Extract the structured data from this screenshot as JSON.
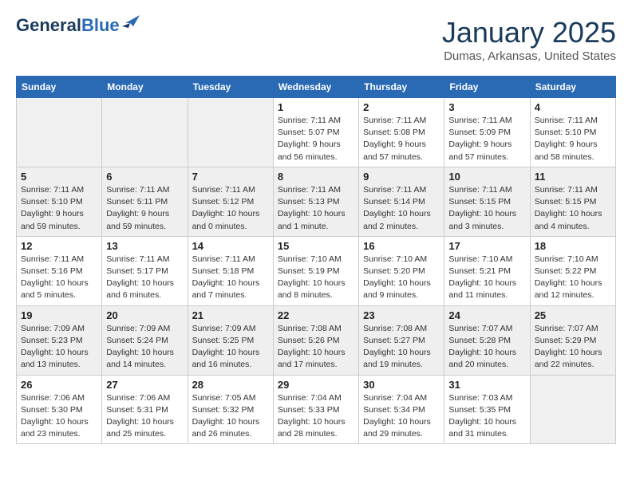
{
  "header": {
    "logo_line1": "General",
    "logo_line2": "Blue",
    "month": "January 2025",
    "location": "Dumas, Arkansas, United States"
  },
  "weekdays": [
    "Sunday",
    "Monday",
    "Tuesday",
    "Wednesday",
    "Thursday",
    "Friday",
    "Saturday"
  ],
  "weeks": [
    [
      {
        "day": "",
        "sunrise": "",
        "sunset": "",
        "daylight": ""
      },
      {
        "day": "",
        "sunrise": "",
        "sunset": "",
        "daylight": ""
      },
      {
        "day": "",
        "sunrise": "",
        "sunset": "",
        "daylight": ""
      },
      {
        "day": "1",
        "sunrise": "Sunrise: 7:11 AM",
        "sunset": "Sunset: 5:07 PM",
        "daylight": "Daylight: 9 hours and 56 minutes."
      },
      {
        "day": "2",
        "sunrise": "Sunrise: 7:11 AM",
        "sunset": "Sunset: 5:08 PM",
        "daylight": "Daylight: 9 hours and 57 minutes."
      },
      {
        "day": "3",
        "sunrise": "Sunrise: 7:11 AM",
        "sunset": "Sunset: 5:09 PM",
        "daylight": "Daylight: 9 hours and 57 minutes."
      },
      {
        "day": "4",
        "sunrise": "Sunrise: 7:11 AM",
        "sunset": "Sunset: 5:10 PM",
        "daylight": "Daylight: 9 hours and 58 minutes."
      }
    ],
    [
      {
        "day": "5",
        "sunrise": "Sunrise: 7:11 AM",
        "sunset": "Sunset: 5:10 PM",
        "daylight": "Daylight: 9 hours and 59 minutes."
      },
      {
        "day": "6",
        "sunrise": "Sunrise: 7:11 AM",
        "sunset": "Sunset: 5:11 PM",
        "daylight": "Daylight: 9 hours and 59 minutes."
      },
      {
        "day": "7",
        "sunrise": "Sunrise: 7:11 AM",
        "sunset": "Sunset: 5:12 PM",
        "daylight": "Daylight: 10 hours and 0 minutes."
      },
      {
        "day": "8",
        "sunrise": "Sunrise: 7:11 AM",
        "sunset": "Sunset: 5:13 PM",
        "daylight": "Daylight: 10 hours and 1 minute."
      },
      {
        "day": "9",
        "sunrise": "Sunrise: 7:11 AM",
        "sunset": "Sunset: 5:14 PM",
        "daylight": "Daylight: 10 hours and 2 minutes."
      },
      {
        "day": "10",
        "sunrise": "Sunrise: 7:11 AM",
        "sunset": "Sunset: 5:15 PM",
        "daylight": "Daylight: 10 hours and 3 minutes."
      },
      {
        "day": "11",
        "sunrise": "Sunrise: 7:11 AM",
        "sunset": "Sunset: 5:15 PM",
        "daylight": "Daylight: 10 hours and 4 minutes."
      }
    ],
    [
      {
        "day": "12",
        "sunrise": "Sunrise: 7:11 AM",
        "sunset": "Sunset: 5:16 PM",
        "daylight": "Daylight: 10 hours and 5 minutes."
      },
      {
        "day": "13",
        "sunrise": "Sunrise: 7:11 AM",
        "sunset": "Sunset: 5:17 PM",
        "daylight": "Daylight: 10 hours and 6 minutes."
      },
      {
        "day": "14",
        "sunrise": "Sunrise: 7:11 AM",
        "sunset": "Sunset: 5:18 PM",
        "daylight": "Daylight: 10 hours and 7 minutes."
      },
      {
        "day": "15",
        "sunrise": "Sunrise: 7:10 AM",
        "sunset": "Sunset: 5:19 PM",
        "daylight": "Daylight: 10 hours and 8 minutes."
      },
      {
        "day": "16",
        "sunrise": "Sunrise: 7:10 AM",
        "sunset": "Sunset: 5:20 PM",
        "daylight": "Daylight: 10 hours and 9 minutes."
      },
      {
        "day": "17",
        "sunrise": "Sunrise: 7:10 AM",
        "sunset": "Sunset: 5:21 PM",
        "daylight": "Daylight: 10 hours and 11 minutes."
      },
      {
        "day": "18",
        "sunrise": "Sunrise: 7:10 AM",
        "sunset": "Sunset: 5:22 PM",
        "daylight": "Daylight: 10 hours and 12 minutes."
      }
    ],
    [
      {
        "day": "19",
        "sunrise": "Sunrise: 7:09 AM",
        "sunset": "Sunset: 5:23 PM",
        "daylight": "Daylight: 10 hours and 13 minutes."
      },
      {
        "day": "20",
        "sunrise": "Sunrise: 7:09 AM",
        "sunset": "Sunset: 5:24 PM",
        "daylight": "Daylight: 10 hours and 14 minutes."
      },
      {
        "day": "21",
        "sunrise": "Sunrise: 7:09 AM",
        "sunset": "Sunset: 5:25 PM",
        "daylight": "Daylight: 10 hours and 16 minutes."
      },
      {
        "day": "22",
        "sunrise": "Sunrise: 7:08 AM",
        "sunset": "Sunset: 5:26 PM",
        "daylight": "Daylight: 10 hours and 17 minutes."
      },
      {
        "day": "23",
        "sunrise": "Sunrise: 7:08 AM",
        "sunset": "Sunset: 5:27 PM",
        "daylight": "Daylight: 10 hours and 19 minutes."
      },
      {
        "day": "24",
        "sunrise": "Sunrise: 7:07 AM",
        "sunset": "Sunset: 5:28 PM",
        "daylight": "Daylight: 10 hours and 20 minutes."
      },
      {
        "day": "25",
        "sunrise": "Sunrise: 7:07 AM",
        "sunset": "Sunset: 5:29 PM",
        "daylight": "Daylight: 10 hours and 22 minutes."
      }
    ],
    [
      {
        "day": "26",
        "sunrise": "Sunrise: 7:06 AM",
        "sunset": "Sunset: 5:30 PM",
        "daylight": "Daylight: 10 hours and 23 minutes."
      },
      {
        "day": "27",
        "sunrise": "Sunrise: 7:06 AM",
        "sunset": "Sunset: 5:31 PM",
        "daylight": "Daylight: 10 hours and 25 minutes."
      },
      {
        "day": "28",
        "sunrise": "Sunrise: 7:05 AM",
        "sunset": "Sunset: 5:32 PM",
        "daylight": "Daylight: 10 hours and 26 minutes."
      },
      {
        "day": "29",
        "sunrise": "Sunrise: 7:04 AM",
        "sunset": "Sunset: 5:33 PM",
        "daylight": "Daylight: 10 hours and 28 minutes."
      },
      {
        "day": "30",
        "sunrise": "Sunrise: 7:04 AM",
        "sunset": "Sunset: 5:34 PM",
        "daylight": "Daylight: 10 hours and 29 minutes."
      },
      {
        "day": "31",
        "sunrise": "Sunrise: 7:03 AM",
        "sunset": "Sunset: 5:35 PM",
        "daylight": "Daylight: 10 hours and 31 minutes."
      },
      {
        "day": "",
        "sunrise": "",
        "sunset": "",
        "daylight": ""
      }
    ]
  ]
}
